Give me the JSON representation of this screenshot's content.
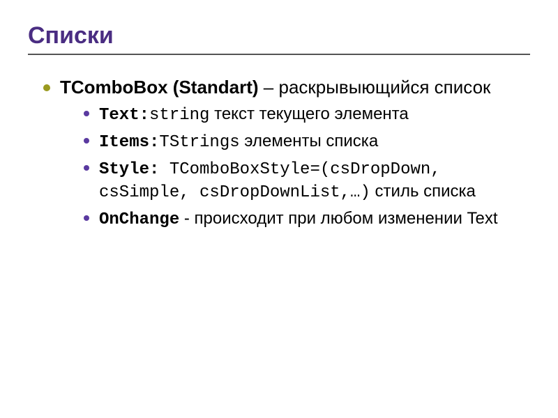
{
  "title": "Списки",
  "outer": {
    "component": "TComboBox",
    "component_note": "(Standart)",
    "component_dash": " – ",
    "component_desc": "раскрывыющийся список"
  },
  "items": [
    {
      "prop": "Text:",
      "type": "string",
      "desc": " текст текущего элемента"
    },
    {
      "prop": "Items:",
      "type": "TStrings",
      "desc": " элементы списка"
    },
    {
      "prop": "Style:",
      "type": " TComboBoxStyle=(csDropDown, csSimple, csDropDownList,…)",
      "desc": " стиль списка"
    },
    {
      "prop": "OnChange",
      "type": "",
      "desc": " - происходит при любом изменении Text"
    }
  ]
}
